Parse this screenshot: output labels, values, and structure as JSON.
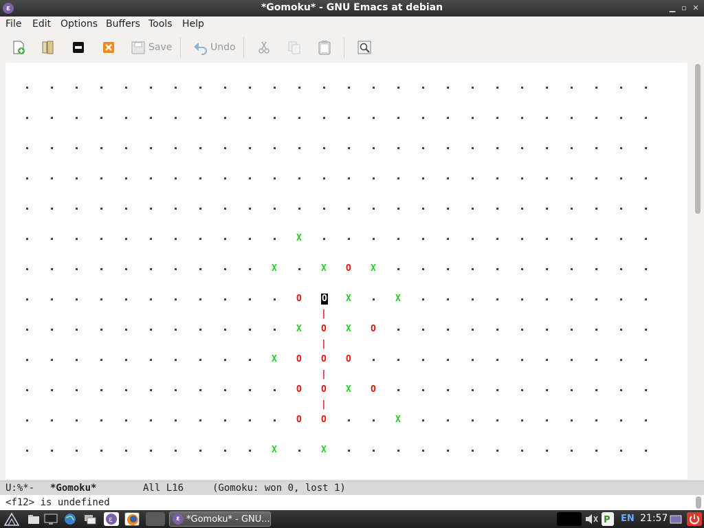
{
  "window": {
    "title": "*Gomoku* - GNU Emacs at debian"
  },
  "menu": [
    "File",
    "Edit",
    "Options",
    "Buffers",
    "Tools",
    "Help"
  ],
  "toolbar": {
    "save_label": "Save",
    "undo_label": "Undo"
  },
  "board": {
    "columns": 26,
    "rows": 13,
    "stones": [
      {
        "row": 5,
        "col": 11,
        "piece": "X"
      },
      {
        "row": 6,
        "col": 10,
        "piece": "X"
      },
      {
        "row": 6,
        "col": 12,
        "piece": "X"
      },
      {
        "row": 6,
        "col": 13,
        "piece": "O"
      },
      {
        "row": 6,
        "col": 14,
        "piece": "X"
      },
      {
        "row": 7,
        "col": 11,
        "piece": "O"
      },
      {
        "row": 7,
        "col": 12,
        "piece": "O",
        "cursor": true
      },
      {
        "row": 7,
        "col": 13,
        "piece": "X"
      },
      {
        "row": 7,
        "col": 15,
        "piece": "X"
      },
      {
        "row": 8,
        "col": 11,
        "piece": "X"
      },
      {
        "row": 8,
        "col": 12,
        "piece": "O"
      },
      {
        "row": 8,
        "col": 13,
        "piece": "X"
      },
      {
        "row": 8,
        "col": 14,
        "piece": "O"
      },
      {
        "row": 9,
        "col": 10,
        "piece": "X"
      },
      {
        "row": 9,
        "col": 11,
        "piece": "O"
      },
      {
        "row": 9,
        "col": 12,
        "piece": "O"
      },
      {
        "row": 9,
        "col": 13,
        "piece": "O"
      },
      {
        "row": 10,
        "col": 11,
        "piece": "O"
      },
      {
        "row": 10,
        "col": 12,
        "piece": "O"
      },
      {
        "row": 10,
        "col": 13,
        "piece": "X"
      },
      {
        "row": 10,
        "col": 14,
        "piece": "O"
      },
      {
        "row": 11,
        "col": 11,
        "piece": "O"
      },
      {
        "row": 11,
        "col": 12,
        "piece": "O"
      },
      {
        "row": 11,
        "col": 15,
        "piece": "X"
      },
      {
        "row": 12,
        "col": 10,
        "piece": "X"
      },
      {
        "row": 12,
        "col": 12,
        "piece": "X"
      }
    ],
    "winning_line": {
      "col": 12,
      "from_row": 7,
      "to_row": 11,
      "glyph": "|"
    }
  },
  "modeline": {
    "status": "U:%*-",
    "buffer": "*Gomoku*",
    "position": "All L16",
    "mode": "(Gomoku: won 0, lost 1)"
  },
  "echo": "<f12> is undefined",
  "taskbar": {
    "task_label": "*Gomoku* - GNU...",
    "lang": "EN",
    "clock": "21:57"
  },
  "colors": {
    "x_piece": "#28cc28",
    "o_piece": "#e01414",
    "cursor_bg": "#000000"
  }
}
